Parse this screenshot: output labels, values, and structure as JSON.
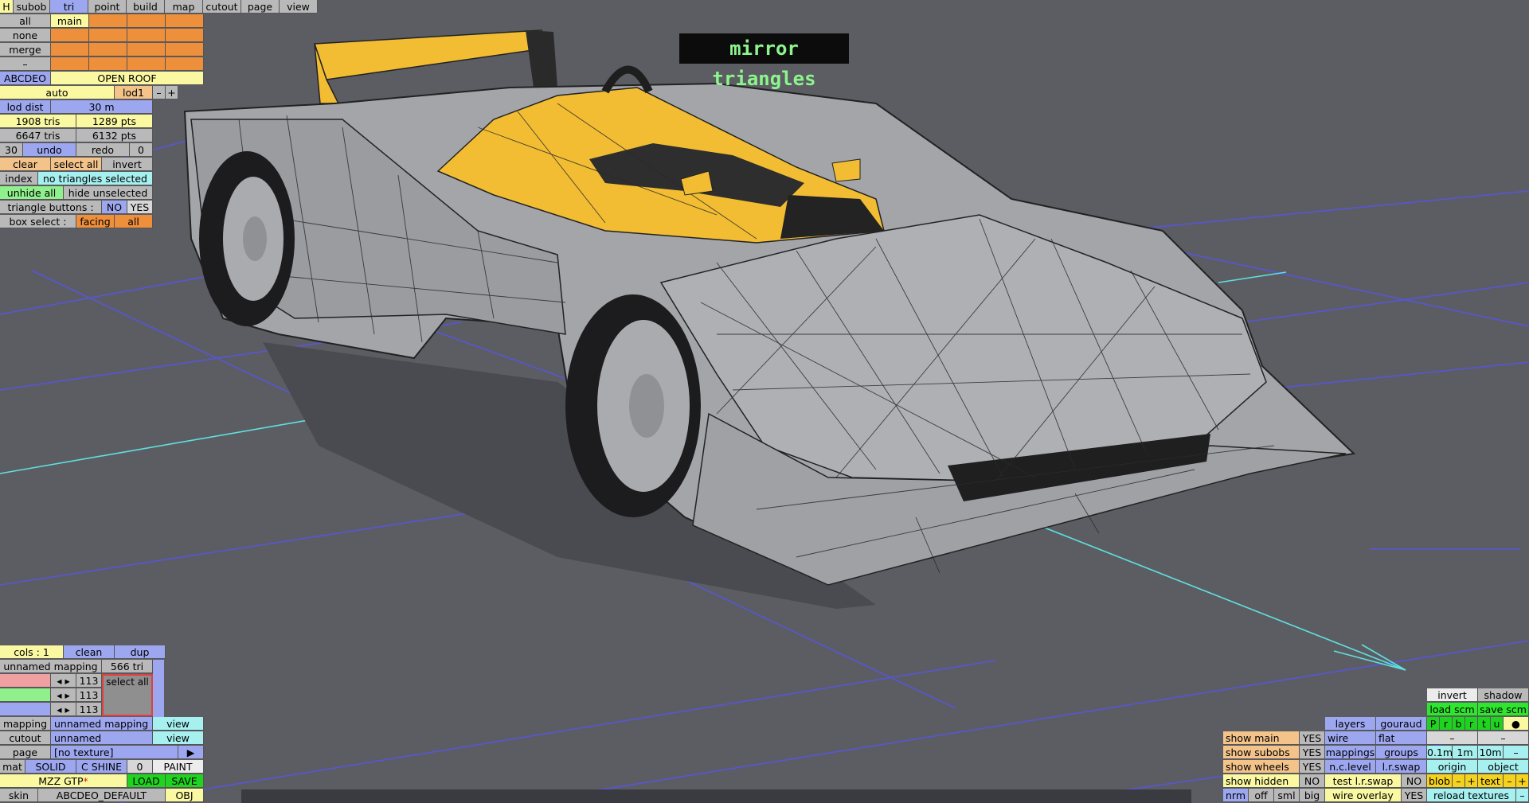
{
  "banner": "mirror triangles",
  "menu": {
    "h": "H",
    "items": [
      "subob",
      "tri",
      "point",
      "build",
      "map",
      "cutout",
      "page",
      "view"
    ]
  },
  "left": {
    "all": "all",
    "main": "main",
    "none": "none",
    "merge": "merge",
    "dash": "–",
    "abcdeo": "ABCDEO",
    "open_roof": "OPEN ROOF",
    "auto": "auto",
    "lod1": "lod1",
    "minus": "–",
    "plus": "+",
    "lod_dist_label": "lod dist",
    "lod_dist_value": "30 m",
    "tris1": "1908 tris",
    "pts1": "1289 pts",
    "tris2": "6647 tris",
    "pts2": "6132 pts",
    "undo_count": "30",
    "undo": "undo",
    "redo": "redo",
    "redo_count": "0",
    "clear": "clear",
    "select_all": "select all",
    "invert": "invert",
    "index": "index",
    "index_status": "no triangles selected",
    "unhide_all": "unhide all",
    "hide_unselected": "hide unselected",
    "triangle_buttons": "triangle buttons :",
    "no": "NO",
    "yes": "YES",
    "box_select": "box select :",
    "facing": "facing",
    "box_all": "all"
  },
  "bottom_left": {
    "cols": "cols : 1",
    "clean": "clean",
    "dup": "dup",
    "mapping_name": "unnamed mapping",
    "tri_count": "566 tri",
    "ch1": "113",
    "ch2": "113",
    "ch3": "113",
    "select_all": "select all",
    "mapping": "mapping",
    "mapping_value": "unnamed mapping",
    "view1": "view",
    "cutout": "cutout",
    "cutout_value": "unnamed",
    "view2": "view",
    "page": "page",
    "page_value": "[no texture]",
    "play": "▶",
    "mat": "mat",
    "solid": "SOLID",
    "c_shine": "C SHINE",
    "zero": "0",
    "paint": "PAINT",
    "car_name": "MZZ GTP",
    "asterisk": "*",
    "load": "LOAD",
    "save": "SAVE",
    "skin": "skin",
    "skin_value": "ABCDEO_DEFAULT",
    "obj": "OBJ"
  },
  "bottom_right": {
    "invert": "invert",
    "shadow": "shadow",
    "load_scm": "load scm",
    "save_scm": "save scm",
    "letters": [
      "P",
      "r",
      "b",
      "r",
      "t",
      "u"
    ],
    "dot": "●",
    "layers": "layers",
    "gouraud": "gouraud",
    "show_main": "show main",
    "show_main_v": "YES",
    "wire": "wire",
    "flat": "flat",
    "show_subobs": "show subobs",
    "show_subobs_v": "YES",
    "mappings": "mappings",
    "groups": "groups",
    "s01": "0.1m",
    "s1": "1m",
    "s10": "10m",
    "sm": "–",
    "show_wheels": "show wheels",
    "show_wheels_v": "YES",
    "nclevel": "n.c.level",
    "lrswap": "l.r.swap",
    "origin": "origin",
    "object": "object",
    "show_hidden": "show hidden",
    "show_hidden_v": "NO",
    "test_lrswap": "test l.r.swap",
    "test_lrswap_v": "NO",
    "blob": "blob",
    "bminus": "–",
    "bplus": "+",
    "text": "text",
    "tminus": "–",
    "tplus": "+",
    "nrm": "nrm",
    "off": "off",
    "sml": "sml",
    "big": "big",
    "wire_overlay": "wire overlay",
    "wire_overlay_v": "YES",
    "reload_textures": "reload textures",
    "rminus": "–",
    "dash1": "–",
    "dash2": "–"
  },
  "colors": {
    "background": "#5c5d63",
    "grid": "#5a5ad8",
    "axis": "#5fe0e0",
    "car_body": "#a3a5a9",
    "car_yellow": "#f2bd33"
  }
}
